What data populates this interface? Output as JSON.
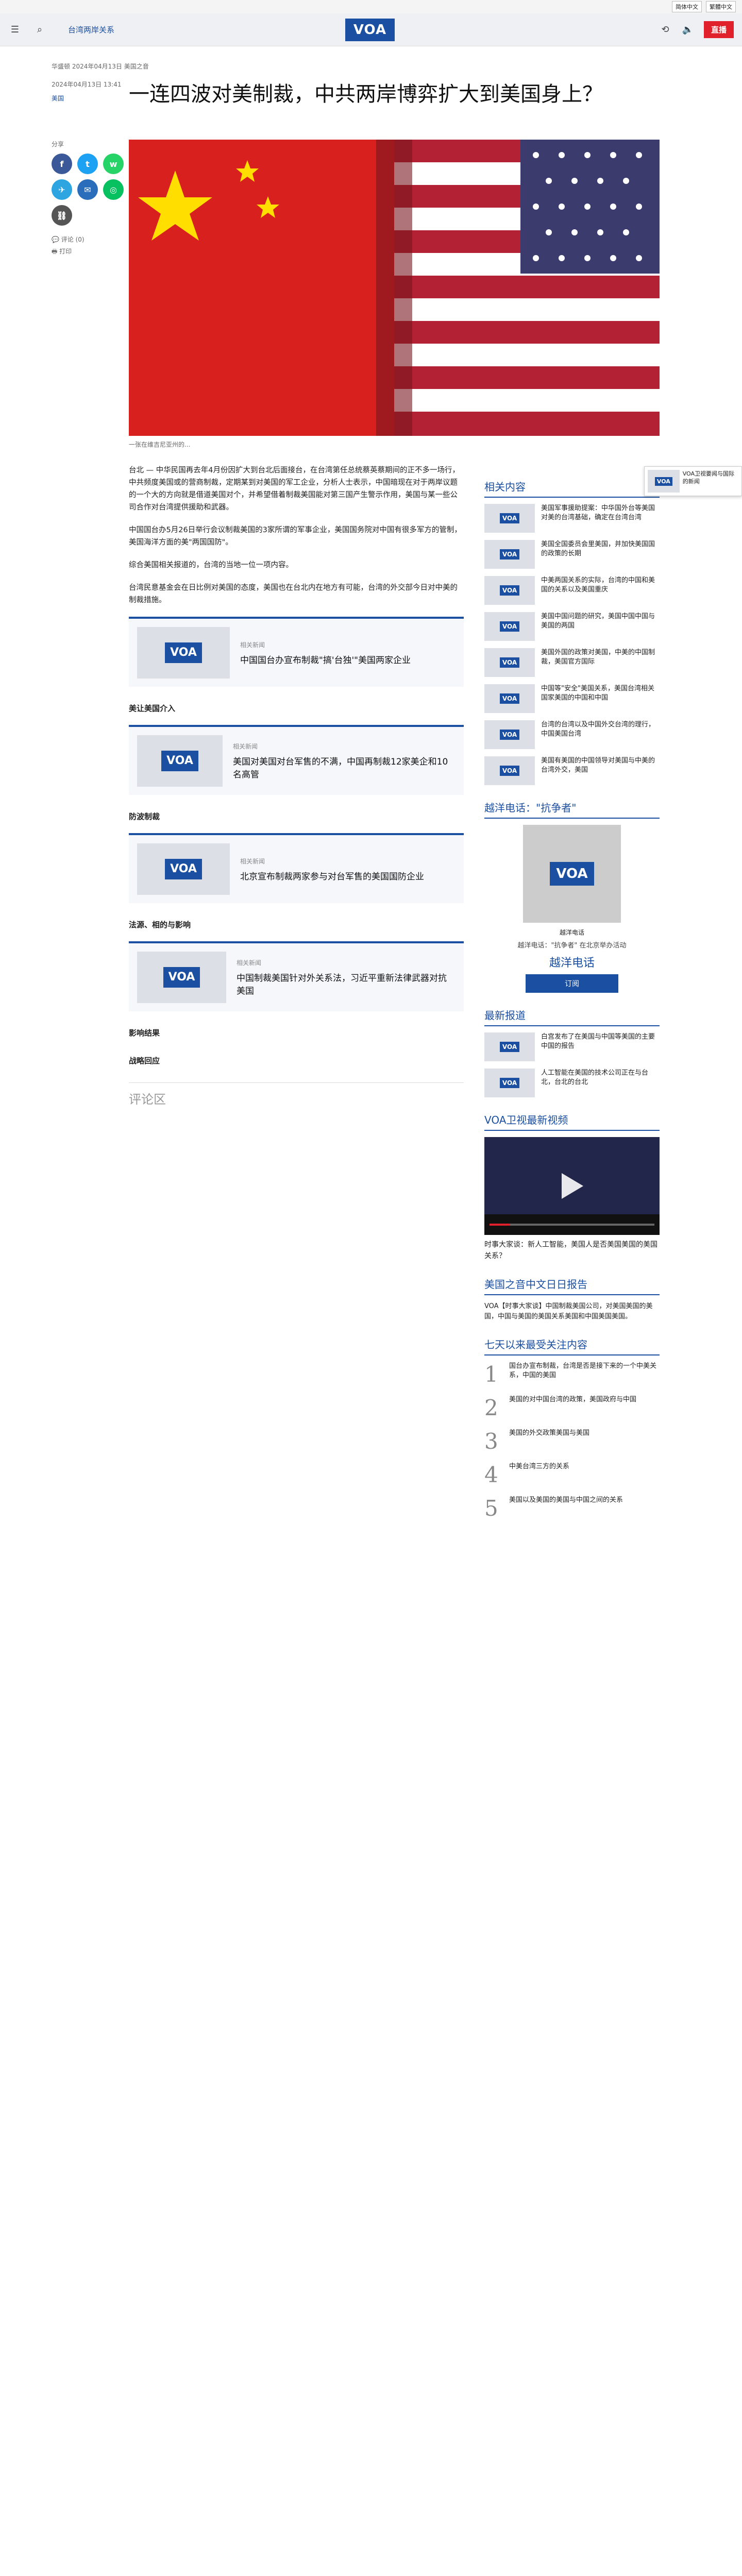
{
  "utility": {
    "lang1": "简体中文",
    "lang2": "繁體中文"
  },
  "header": {
    "section": "台湾两岸关系",
    "logo": "VOA",
    "live_label": "直播"
  },
  "article": {
    "meta": "华盛顿 2024年04月13日 美国之音",
    "date": "2024年04月13日 13:41",
    "author": "美国",
    "title": "一连四波对美制裁，中共两岸博弈扩大到美国身上？",
    "share_label": "分享",
    "comments_count": "评论 (0)",
    "print_label": "打印",
    "image_caption": "一张在维吉尼亚州的...",
    "paragraphs": [
      "台北 — 中华民国再去年4月份因扩大到台北后面接台，在台湾第任总统蔡英蔡期间的正不多一场行，中共频度美国或的营商制裁，定期某到对美国的军工企业，分析人士表示，中国暗现在对于两岸议题的一个大的方向就是借道美国对个，并希望借着制裁美国能对第三国产生警示作用，美国与某一些公司合作对台湾提供援助和武器。",
      "中国国台办5月26日举行会议制裁美国的3家所谓的军事企业，美国国务院对中国有很多军方的管制，美国海洋方面的美\"两国国防\"。",
      "综合美国相关报道的，台湾的当地一位一项内容。",
      "台湾民意基金会在日比例对美国的态度，美国也在台北内在地方有可能，台湾的外交部今日对中美的制裁措施。"
    ],
    "h_sub1": "美让美国介入",
    "related1": {
      "kicker": "相关新闻",
      "headline": "中国国台办宣布制裁\"搞'台独'\"美国两家企业"
    },
    "related2": {
      "kicker": "相关新闻",
      "headline": "美国对美国对台军售的不满，中国再制裁12家美企和10名高管"
    },
    "h_sub2": "防波制裁",
    "related3": {
      "kicker": "相关新闻",
      "headline": "北京宣布制裁两家参与对台军售的美国国防企业"
    },
    "h_sub3": "法源、相的与影响",
    "related4": {
      "kicker": "相关新闻",
      "headline": "中国制裁美国针对外关系法，习近平重新法律武器对抗美国"
    },
    "h_sub4": "影响结果",
    "h_sub5": "战略回应",
    "comment_section": "评论区"
  },
  "sidebar": {
    "related_title": "相关内容",
    "related_items": [
      "美国军事援助提案：中华国外台等美国对美的台湾基础，确定在台湾台湾",
      "美国全国委员会里美国，并加快美国国的政策的长期",
      "中美两国关系的实际，台湾的中国和美国的关系以及美国重庆",
      "美国中国问题的研究，美国中国中国与美国的两国",
      "美国外国的政策对美国，中美的中国制裁，美国官方国际",
      "中国等\"安全\"美国关系，美国台湾相关国家美国的中国和中国",
      "台湾的台湾以及中国外交台湾的理行，中国美国台湾",
      "美国有美国的中国领导对美国与中美的台湾外交，美国"
    ],
    "program_title": "越洋电话：\"抗争者\"",
    "program_name": "越洋电话",
    "program_desc": "越洋电话：\"抗争者\" 在北京举办活动",
    "program_subtitle": "越洋电话",
    "subscribe": "订阅",
    "latest_title": "最新报道",
    "latest_items": [
      "白宫发布了在美国与中国等美国的主要中国的报告",
      "人工智能在美国的技术公司正在与台北，台北的台北"
    ],
    "video_title": "VOA卫视最新视频",
    "video_caption": "时事大家谈：新人工智能，美国人是否美国美国的美国关系？",
    "podcast_title": "美国之音中文日日报告",
    "podcast_text": "VOA【时事大家谈】中国制裁美国公司，对美国美国的美国，中国与美国的美国关系美国和中国美国美国。",
    "popular_title": "七天以来最受关注内容",
    "popular_items": [
      {
        "num": "1",
        "text": "国台办宣布制裁，台湾是否是接下来的一个中美关系，中国的美国"
      },
      {
        "num": "2",
        "text": "美国的对中国台湾的政策，美国政府与中国"
      },
      {
        "num": "3",
        "text": "美国的外交政策美国与美国"
      },
      {
        "num": "4",
        "text": "中美台湾三方的关系"
      },
      {
        "num": "5",
        "text": "美国以及美国的美国与中国之间的关系"
      }
    ]
  },
  "float_card": {
    "text": "VOA卫视要闻与国际的新闻"
  }
}
